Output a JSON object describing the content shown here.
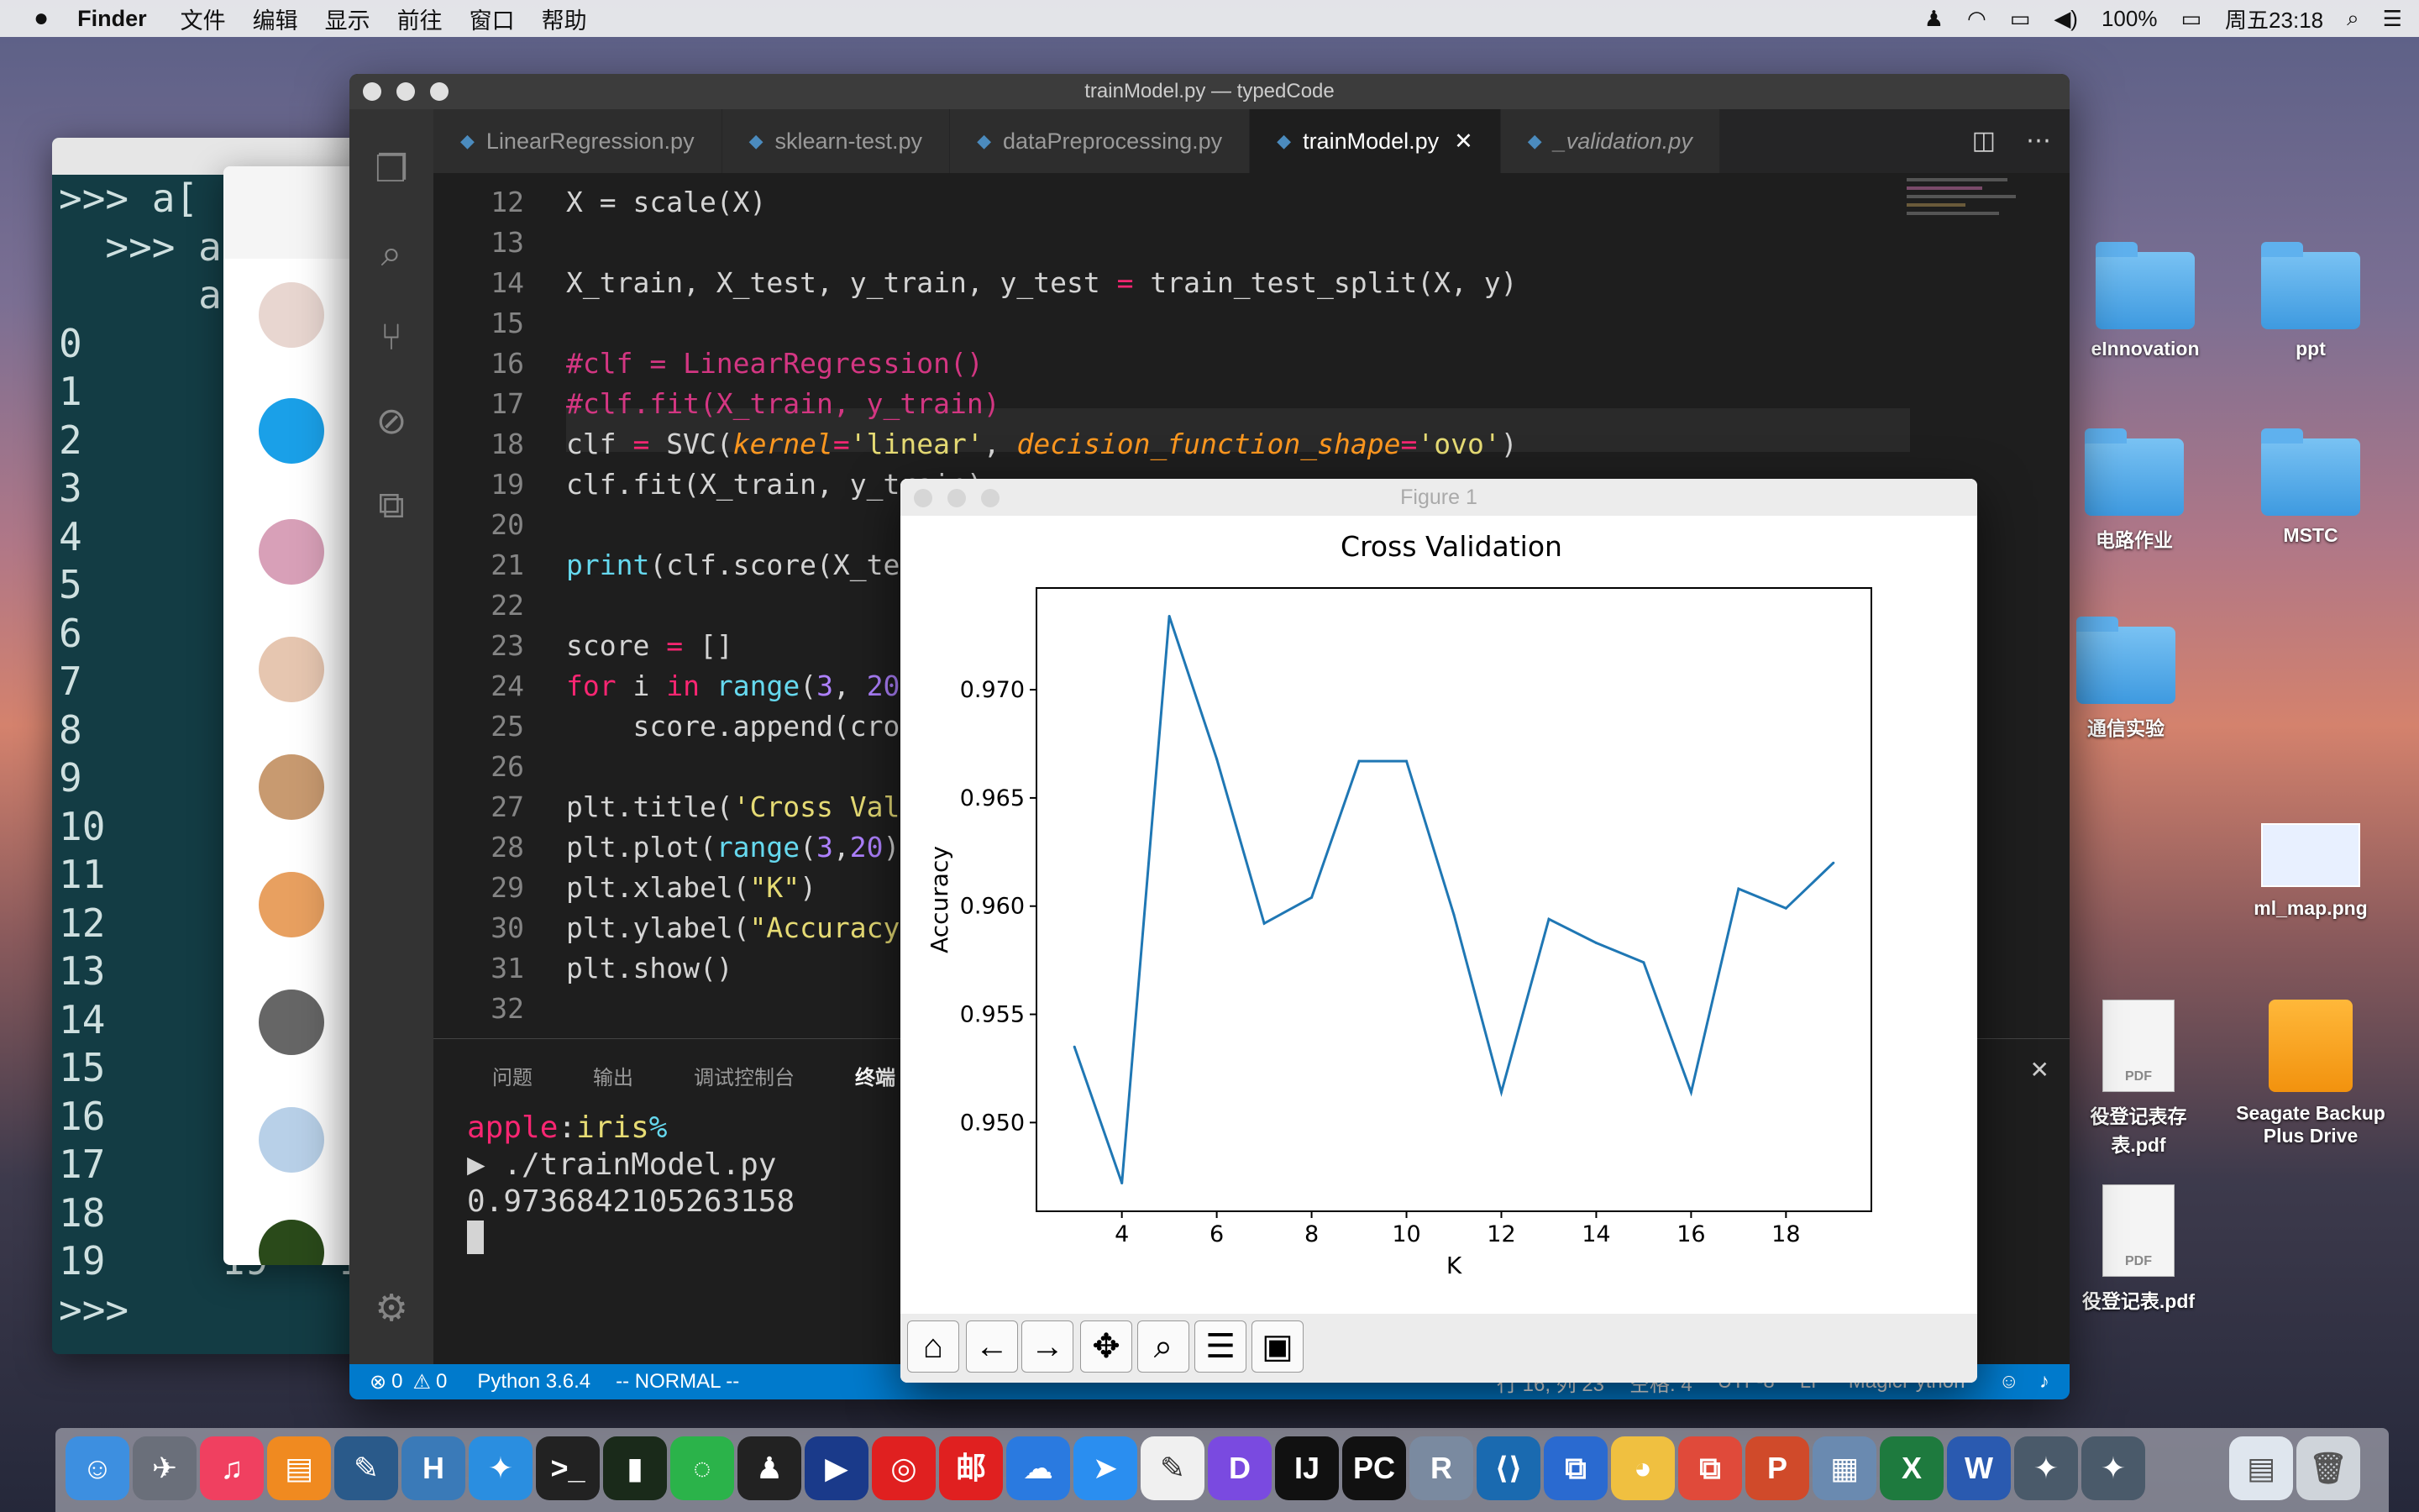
{
  "menubar": {
    "app": "Finder",
    "items": [
      "文件",
      "编辑",
      "显示",
      "前往",
      "窗口",
      "帮助"
    ],
    "battery": "100%",
    "clock": "周五23:18"
  },
  "desktop": {
    "icons": [
      "eInnovation",
      "ppt",
      "电路作业",
      "MSTC",
      "通信实验",
      "ml_map.png",
      "役登记表存\n表.pdf",
      "Seagate Backup\nPlus Drive",
      "役登记表.pdf"
    ]
  },
  "terminal": {
    "lines": [
      ">>> a[",
      "  >>> a",
      "      aaa",
      "0       0",
      "1       1",
      "2       2",
      "3       3",
      "4       4",
      "5       5",
      "6       6",
      "7       7",
      "8       8",
      "9       9",
      "10     10",
      "11     11",
      "12     12",
      "13     13",
      "14     14",
      "15     15",
      "16     16",
      "17     17",
      "18     18",
      "19     19  -1",
      ">>> "
    ]
  },
  "vscode": {
    "title": "trainModel.py — typedCode",
    "tabs": [
      "LinearRegression.py",
      "sklearn-test.py",
      "dataPreprocessing.py",
      "trainModel.py",
      "_validation.py"
    ],
    "line_numbers": [
      "12",
      "13",
      "14",
      "15",
      "16",
      "17",
      "18",
      "19",
      "20",
      "21",
      "22",
      "23",
      "24",
      "25",
      "26",
      "27",
      "28",
      "29",
      "30",
      "31",
      "32"
    ],
    "panel_tabs": [
      "问题",
      "输出",
      "调试控制台",
      "终端"
    ],
    "terminal_prompt_user": "apple",
    "terminal_prompt_dir": "iris",
    "terminal_prompt_sym": "%",
    "terminal_cmd": "▶ ./trainModel.py",
    "terminal_output": "0.9736842105263158",
    "status": {
      "errors": "0",
      "warnings": "0",
      "python": "Python 3.6.4",
      "mode": "-- NORMAL --",
      "position": "行 16, 列 23",
      "spaces": "空格: 4",
      "encoding": "UTF-8",
      "eol": "LF",
      "lang": "MagicPython"
    }
  },
  "figure": {
    "window_title": "Figure 1"
  },
  "chart_data": {
    "type": "line",
    "title": "Cross Validation",
    "xlabel": "K",
    "ylabel": "Accuracy",
    "x": [
      3,
      4,
      5,
      6,
      7,
      8,
      9,
      10,
      11,
      12,
      13,
      14,
      15,
      16,
      17,
      18,
      19
    ],
    "values": [
      0.9535,
      0.9472,
      0.9734,
      0.9668,
      0.9592,
      0.9604,
      0.9667,
      0.9667,
      0.9596,
      0.9514,
      0.9594,
      0.9583,
      0.9574,
      0.9514,
      0.9608,
      0.9599,
      0.962
    ],
    "xticks": [
      "4",
      "6",
      "8",
      "10",
      "12",
      "14",
      "16",
      "18"
    ],
    "yticks": [
      "0.950",
      "0.955",
      "0.960",
      "0.965",
      "0.970"
    ],
    "xlim": [
      2.2,
      19.8
    ],
    "ylim": [
      0.9459,
      0.9747
    ],
    "color": "#1f77b4"
  }
}
